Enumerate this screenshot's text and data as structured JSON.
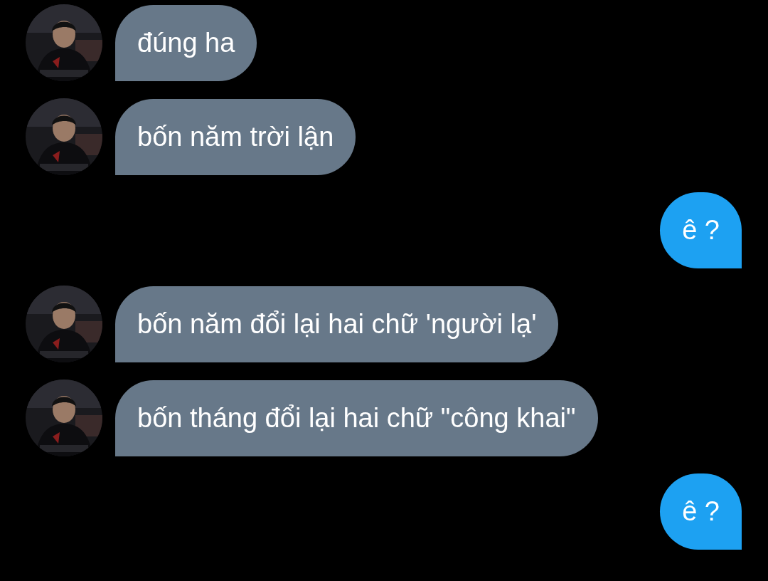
{
  "messages": [
    {
      "kind": "received",
      "text": "đúng ha"
    },
    {
      "kind": "received",
      "text": "bốn năm trời lận"
    },
    {
      "kind": "sent",
      "text": "ê ?"
    },
    {
      "kind": "received",
      "text": "bốn năm đổi lại hai chữ 'người lạ'"
    },
    {
      "kind": "received",
      "text": "bốn tháng đổi lại hai chữ \"công khai\""
    },
    {
      "kind": "sent",
      "text": "ê ?"
    }
  ]
}
